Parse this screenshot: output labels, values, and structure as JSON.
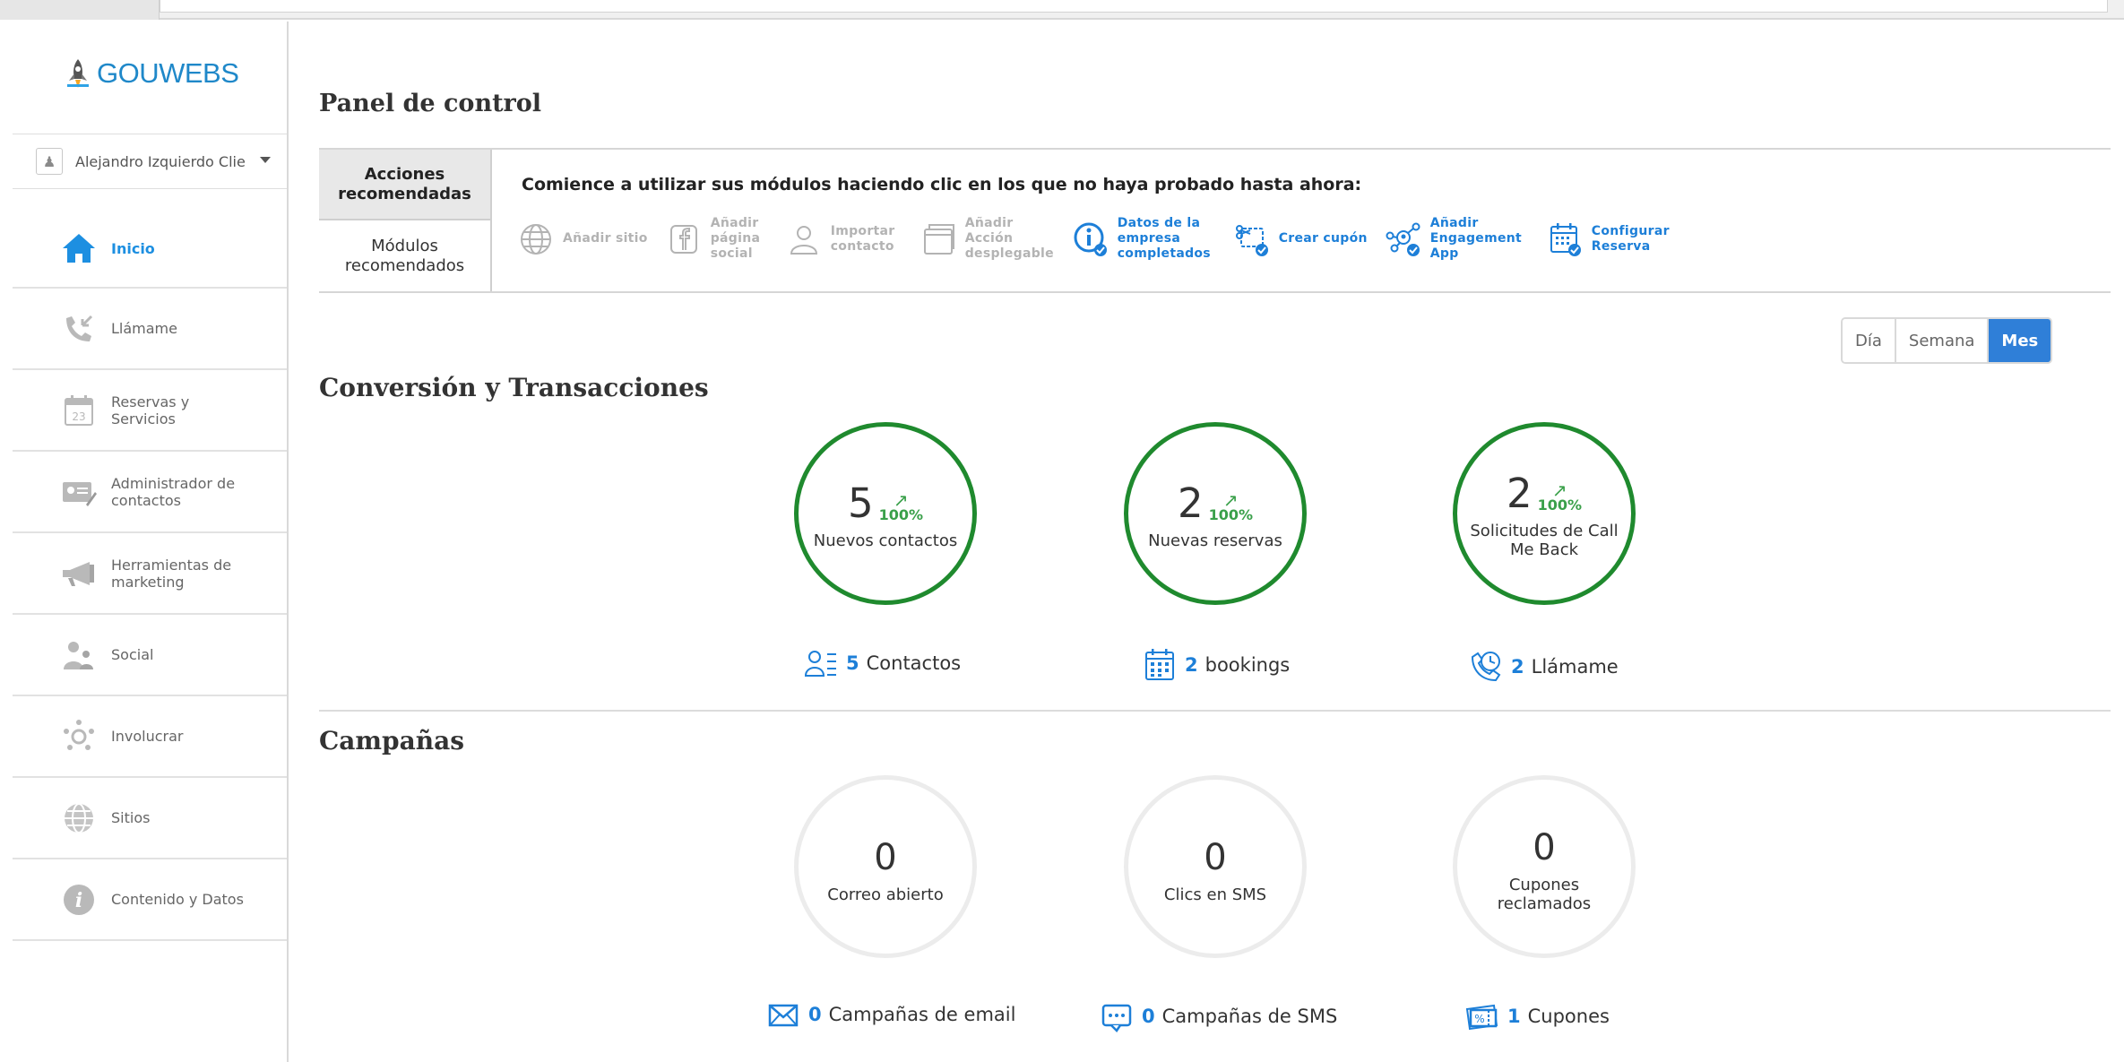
{
  "brand": {
    "name": "GOUWEBS",
    "color": "#1f88c9"
  },
  "user": {
    "name": "Alejandro Izquierdo Clie"
  },
  "sidebar": {
    "items": [
      {
        "label": "Inicio",
        "icon": "home-icon",
        "active": true
      },
      {
        "label": "Llámame",
        "icon": "phone-callback-icon"
      },
      {
        "label": "Reservas y Servicios",
        "icon": "calendar-icon"
      },
      {
        "label": "Administrador de contactos",
        "icon": "contact-card-icon"
      },
      {
        "label": "Herramientas de marketing",
        "icon": "megaphone-icon"
      },
      {
        "label": "Social",
        "icon": "people-icon"
      },
      {
        "label": "Involucrar",
        "icon": "engage-network-icon"
      },
      {
        "label": "Sitios",
        "icon": "globe-icon"
      },
      {
        "label": "Contenido y Datos",
        "icon": "info-icon"
      }
    ]
  },
  "page": {
    "title": "Panel de control"
  },
  "recommendations": {
    "tabs": [
      {
        "label": "Acciones recomendadas",
        "selected": true
      },
      {
        "label": "Módulos recomendados",
        "selected": false
      }
    ],
    "headline": "Comience a utilizar sus módulos haciendo clic en los que no haya probado hasta ahora:",
    "modules": [
      {
        "label": "Añadir sitio",
        "icon": "globe-icon",
        "done": false
      },
      {
        "label": "Añadir página social",
        "icon": "facebook-icon",
        "done": false
      },
      {
        "label": "Importar contacto",
        "icon": "person-icon",
        "done": false
      },
      {
        "label": "Añadir Acción desplegable",
        "icon": "window-icon",
        "done": false
      },
      {
        "label": "Datos de la empresa completados",
        "icon": "info-check-icon",
        "done": true
      },
      {
        "label": "Crear cupón",
        "icon": "coupon-check-icon",
        "done": true
      },
      {
        "label": "Añadir Engagement App",
        "icon": "engagement-check-icon",
        "done": true
      },
      {
        "label": "Configurar Reserva",
        "icon": "calendar-check-icon",
        "done": true
      }
    ]
  },
  "period": {
    "options": [
      "Día",
      "Semana",
      "Mes"
    ],
    "selected": "Mes"
  },
  "conversion": {
    "title": "Conversión y Transacciones",
    "rings": [
      {
        "value": "5",
        "trend": "100%",
        "label": "Nuevos contactos"
      },
      {
        "value": "2",
        "trend": "100%",
        "label": "Nuevas reservas"
      },
      {
        "value": "2",
        "trend": "100%",
        "label": "Solicitudes de Call Me Back"
      }
    ],
    "stats": [
      {
        "icon": "contacts-list-icon",
        "value": "5",
        "label": "Contactos"
      },
      {
        "icon": "calendar-grid-icon",
        "value": "2",
        "label": "bookings"
      },
      {
        "icon": "phone-clock-icon",
        "value": "2",
        "label": "Llámame"
      }
    ]
  },
  "campaigns": {
    "title": "Campañas",
    "rings": [
      {
        "value": "0",
        "label": "Correo abierto"
      },
      {
        "value": "0",
        "label": "Clics en SMS"
      },
      {
        "value": "0",
        "label": "Cupones reclamados"
      }
    ],
    "stats": [
      {
        "icon": "envelope-icon",
        "value": "0",
        "label": "Campañas de email"
      },
      {
        "icon": "sms-bubble-icon",
        "value": "0",
        "label": "Campañas de SMS"
      },
      {
        "icon": "ticket-icon",
        "value": "1",
        "label": "Cupones"
      }
    ]
  },
  "colors": {
    "accent": "#1d7fd8",
    "ring_green": "#1f8a2e",
    "ring_gray": "#ececec",
    "trend_green": "#3aa04a",
    "selected_period": "#2f7fd8"
  }
}
